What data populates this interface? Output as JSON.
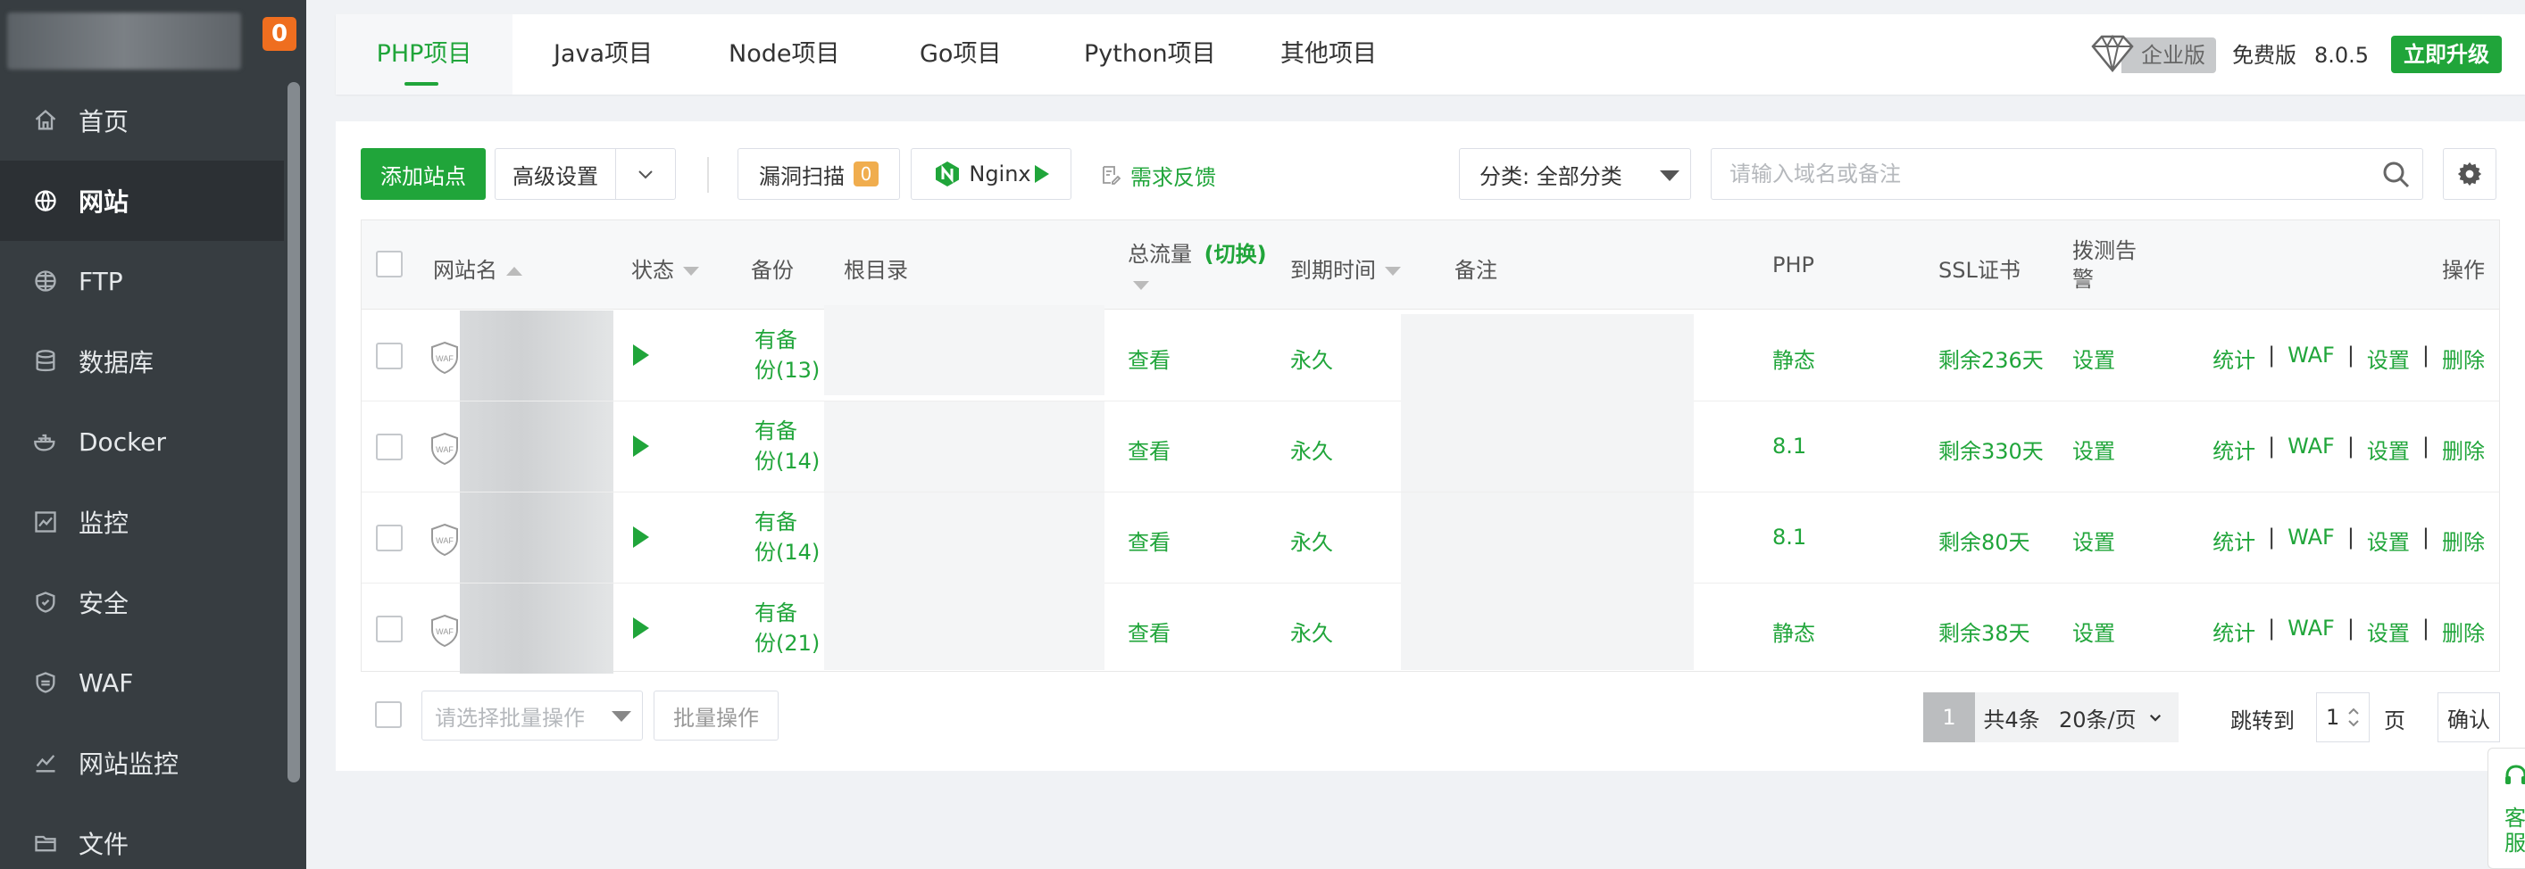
{
  "sidebar": {
    "badge": "0",
    "items": [
      {
        "label": "首页",
        "icon": "home-icon"
      },
      {
        "label": "网站",
        "icon": "globe-icon",
        "active": true
      },
      {
        "label": "FTP",
        "icon": "ftp-icon"
      },
      {
        "label": "数据库",
        "icon": "database-icon"
      },
      {
        "label": "Docker",
        "icon": "docker-icon"
      },
      {
        "label": "监控",
        "icon": "monitor-icon"
      },
      {
        "label": "安全",
        "icon": "shield-icon"
      },
      {
        "label": "WAF",
        "icon": "waf-icon"
      },
      {
        "label": "网站监控",
        "icon": "chart-line-icon"
      },
      {
        "label": "文件",
        "icon": "folder-icon"
      }
    ]
  },
  "tabs": [
    "PHP项目",
    "Java项目",
    "Node项目",
    "Go项目",
    "Python项目",
    "其他项目"
  ],
  "header": {
    "enterprise": "企业版",
    "free": "免费版",
    "version": "8.0.5",
    "upgrade": "立即升级"
  },
  "toolbar": {
    "add_site": "添加站点",
    "advanced": "高级设置",
    "scan": "漏洞扫描",
    "scan_count": "0",
    "nginx": "Nginx",
    "feedback": "需求反馈",
    "category": "分类: 全部分类",
    "search_placeholder": "请输入域名或备注"
  },
  "table": {
    "headers": {
      "name": "网站名",
      "status": "状态",
      "backup": "备份",
      "root": "根目录",
      "traffic": "总流量",
      "traffic_switch": "(切换)",
      "expire": "到期时间",
      "remark": "备注",
      "php": "PHP",
      "ssl": "SSL证书",
      "alert_1": "拨测告",
      "alert_2": "警",
      "ops": "操作"
    },
    "rows": [
      {
        "backup_1": "有备",
        "backup_2": "份(13)",
        "traffic": "查看",
        "expire": "永久",
        "php": "静态",
        "ssl": "剩余236天",
        "alert": "设置"
      },
      {
        "backup_1": "有备",
        "backup_2": "份(14)",
        "traffic": "查看",
        "expire": "永久",
        "php": "8.1",
        "ssl": "剩余330天",
        "alert": "设置"
      },
      {
        "backup_1": "有备",
        "backup_2": "份(14)",
        "traffic": "查看",
        "expire": "永久",
        "php": "8.1",
        "ssl": "剩余80天",
        "alert": "设置"
      },
      {
        "backup_1": "有备",
        "backup_2": "份(21)",
        "traffic": "查看",
        "expire": "永久",
        "php": "静态",
        "ssl": "剩余38天",
        "alert": "设置"
      }
    ],
    "ops": {
      "stats": "统计",
      "waf": "WAF",
      "settings": "设置",
      "delete": "删除",
      "sep": "|"
    },
    "waf_mark": "WAF"
  },
  "footer": {
    "batch_placeholder": "请选择批量操作",
    "batch_btn": "批量操作",
    "current_page": "1",
    "total": "共4条",
    "page_size": "20条/页",
    "jump": "跳转到",
    "jump_value": "1",
    "page_unit": "页",
    "confirm": "确认"
  },
  "kefu": "客服",
  "colors": {
    "accent": "#20a53a",
    "sidebar": "#373d41",
    "badge": "#ef6e1f"
  }
}
